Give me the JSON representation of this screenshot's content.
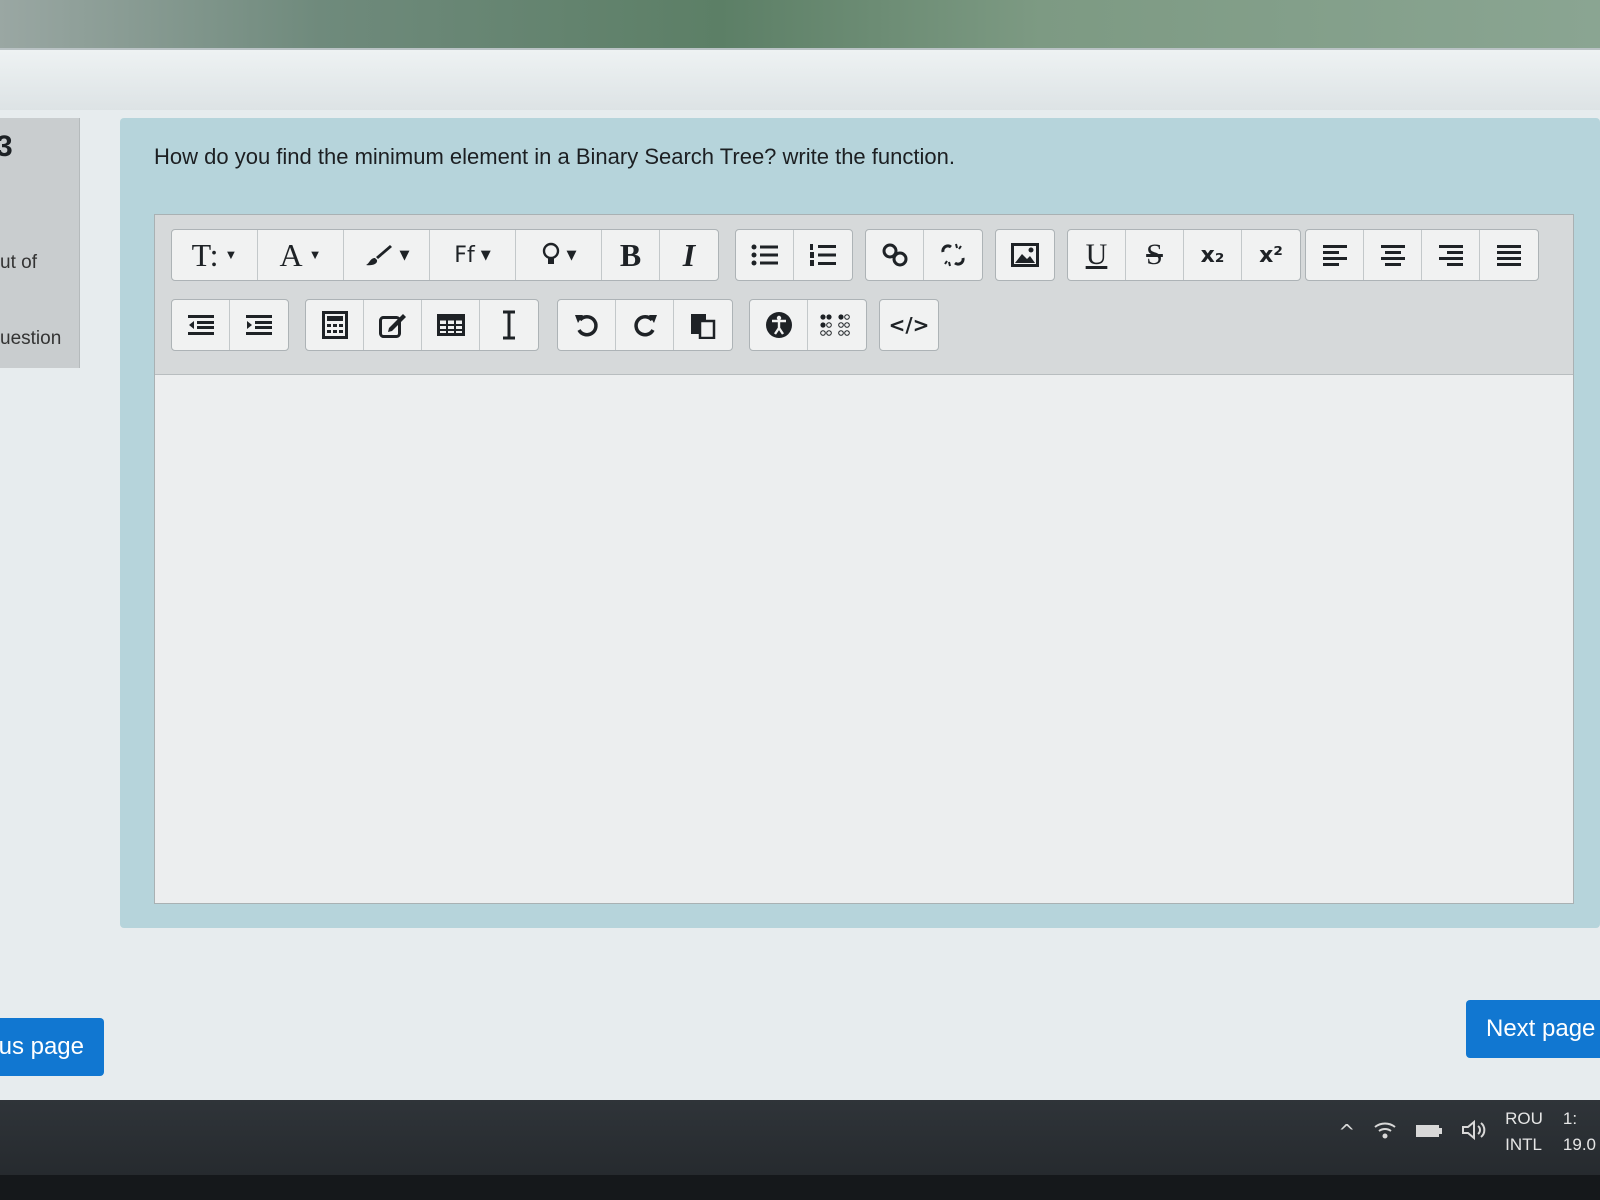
{
  "question": {
    "number": "3",
    "out_of_label": "ut of",
    "flag_label": "uestion",
    "text": "How do you find the minimum element in a Binary Search Tree? write the function."
  },
  "editor": {
    "toolbar_row1": [
      {
        "name": "paragraph-styles-button",
        "icon": "paragraph-styles-icon",
        "label": "T:"
      },
      {
        "name": "font-size-button",
        "icon": "font-size-icon",
        "label": "A"
      },
      {
        "name": "font-color-button",
        "icon": "brush-icon",
        "label": ""
      },
      {
        "name": "font-family-button",
        "icon": "font-family-icon",
        "label": "Ff"
      },
      {
        "name": "highlight-button",
        "icon": "lightbulb-icon",
        "label": ""
      },
      {
        "name": "bold-button",
        "icon": "bold-icon",
        "label": "B"
      },
      {
        "name": "italic-button",
        "icon": "italic-icon",
        "label": "I"
      }
    ],
    "subscript_label": "x₂",
    "superscript_label": "x²",
    "code_label": "</>"
  },
  "navigation": {
    "previous_label": "us page",
    "next_label": "Next page"
  },
  "taskbar": {
    "lang_top": "ROU",
    "lang_bottom": "INTL",
    "time": "1:",
    "date": "19.0"
  },
  "colors": {
    "primary_button": "#1177d1",
    "panel_bg": "#b6d4db",
    "editor_bg": "#eceeef"
  }
}
